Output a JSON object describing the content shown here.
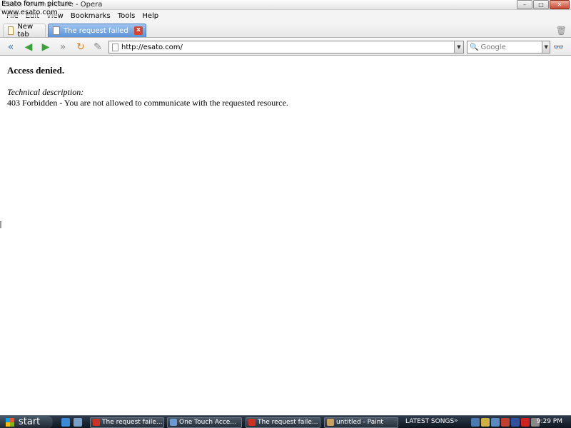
{
  "window": {
    "title": "Esato forum picture - Opera",
    "watermark_line1": "Esato forum picture",
    "watermark_line2": "www.esato.com",
    "min_label": "–",
    "max_label": "□",
    "close_label": "✕"
  },
  "menu": [
    "File",
    "Edit",
    "View",
    "Bookmarks",
    "Tools",
    "Help"
  ],
  "tabs": {
    "new_tab": "New tab",
    "active": "The request failed",
    "close_label": "x"
  },
  "nav": {
    "url": "http://esato.com/",
    "search_placeholder": "Google",
    "search_engine_icon": "google-icon"
  },
  "page": {
    "heading": "Access denied.",
    "desc_label": "Technical description:",
    "desc_text": "403 Forbidden - You are not allowed to communicate with the requested resource."
  },
  "taskbar": {
    "start": "start",
    "tasks": [
      "The request faile...",
      "One Touch Acce...",
      "The request faile...",
      "untitled - Paint"
    ],
    "latest_songs": "LATEST SONGS",
    "chevron": "»",
    "clock": "9:29 PM"
  }
}
